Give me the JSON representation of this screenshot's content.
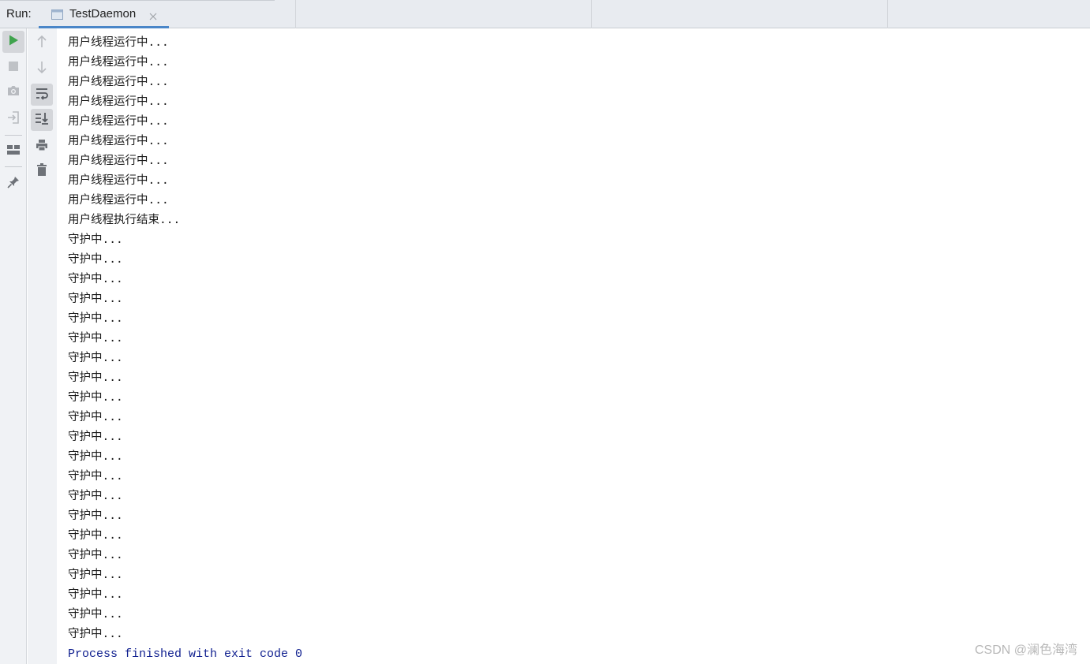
{
  "run_panel": {
    "label": "Run:",
    "tab": {
      "title": "TestDaemon",
      "icon": "run-config-icon",
      "close_icon": "close-icon"
    },
    "accent_color": "#4a86c8"
  },
  "left_toolbar": [
    {
      "icon": "rerun-icon",
      "color": "#3fa34d"
    },
    {
      "icon": "stop-icon"
    },
    {
      "icon": "camera-icon"
    },
    {
      "icon": "login-icon"
    },
    {
      "icon": "layout-icon"
    },
    {
      "icon": "pin-icon"
    }
  ],
  "right_toolbar": [
    {
      "icon": "arrow-up-icon"
    },
    {
      "icon": "arrow-down-icon"
    },
    {
      "icon": "soft-wrap-icon",
      "active": true
    },
    {
      "icon": "scroll-to-end-icon",
      "active": true
    },
    {
      "icon": "print-icon"
    },
    {
      "icon": "trash-icon"
    }
  ],
  "console": {
    "lines": [
      "用户线程运行中...",
      "用户线程运行中...",
      "用户线程运行中...",
      "用户线程运行中...",
      "用户线程运行中...",
      "用户线程运行中...",
      "用户线程运行中...",
      "用户线程运行中...",
      "用户线程运行中...",
      "用户线程运行中...",
      "用户线程执行结束...",
      "守护中...",
      "守护中...",
      "守护中...",
      "守护中...",
      "守护中...",
      "守护中...",
      "守护中...",
      "守护中...",
      "守护中...",
      "守护中...",
      "守护中...",
      "守护中...",
      "守护中...",
      "守护中...",
      "守护中...",
      "守护中...",
      "守护中...",
      "守护中...",
      "守护中...",
      "守护中...",
      "守护中..."
    ],
    "exit_message": "Process finished with exit code 0",
    "exit_color": "#0f1f8f"
  },
  "watermark": "CSDN @澜色海湾"
}
